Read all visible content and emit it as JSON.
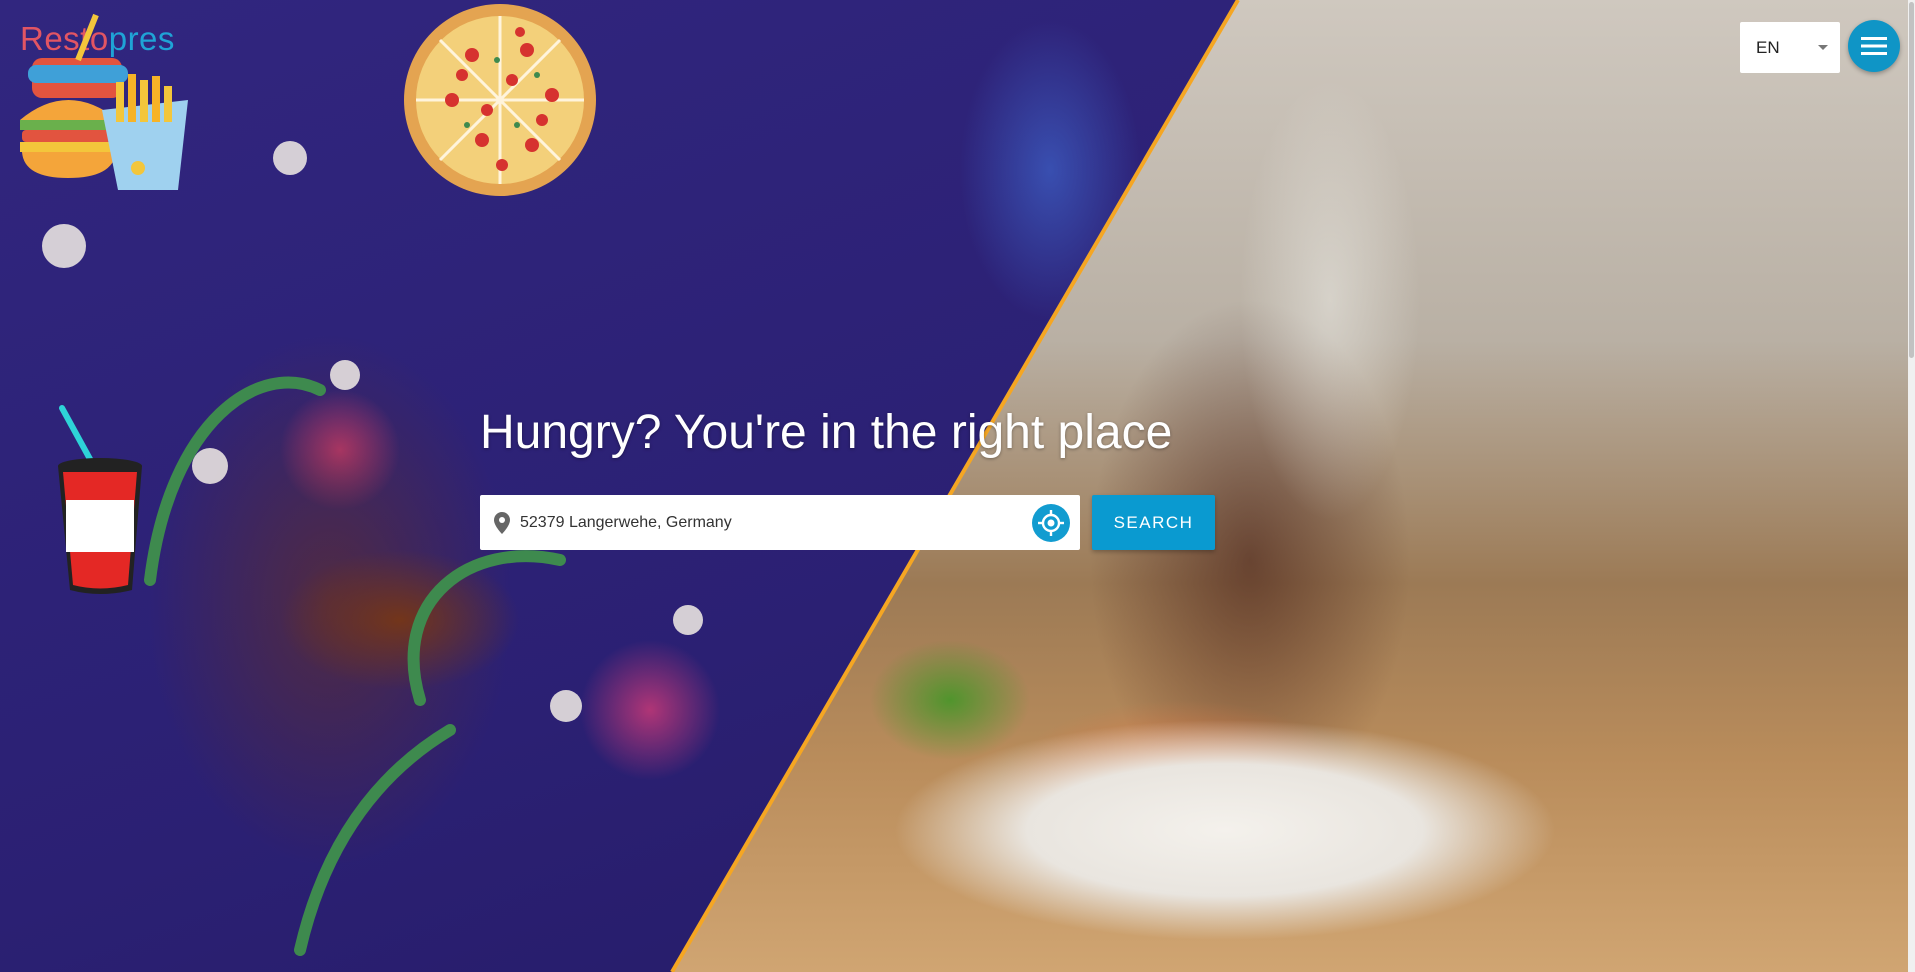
{
  "brand": {
    "logo_part1": "Resto",
    "logo_part2": "pres"
  },
  "header": {
    "language": {
      "selected": "EN"
    },
    "menu_icon": "hamburger-menu-icon"
  },
  "hero": {
    "title": "Hungry? You're in the right place",
    "search": {
      "value": "52379 Langerwehe, Germany",
      "placeholder": "",
      "pin_icon": "map-pin-icon",
      "locate_icon": "gps-locate-icon"
    },
    "search_button": "SEARCH"
  },
  "colors": {
    "logo_red": "#e25563",
    "logo_blue": "#1fa3d6",
    "accent": "#0a9ad0",
    "divider_orange": "#f5a623",
    "left_bg": "#2b2073"
  }
}
